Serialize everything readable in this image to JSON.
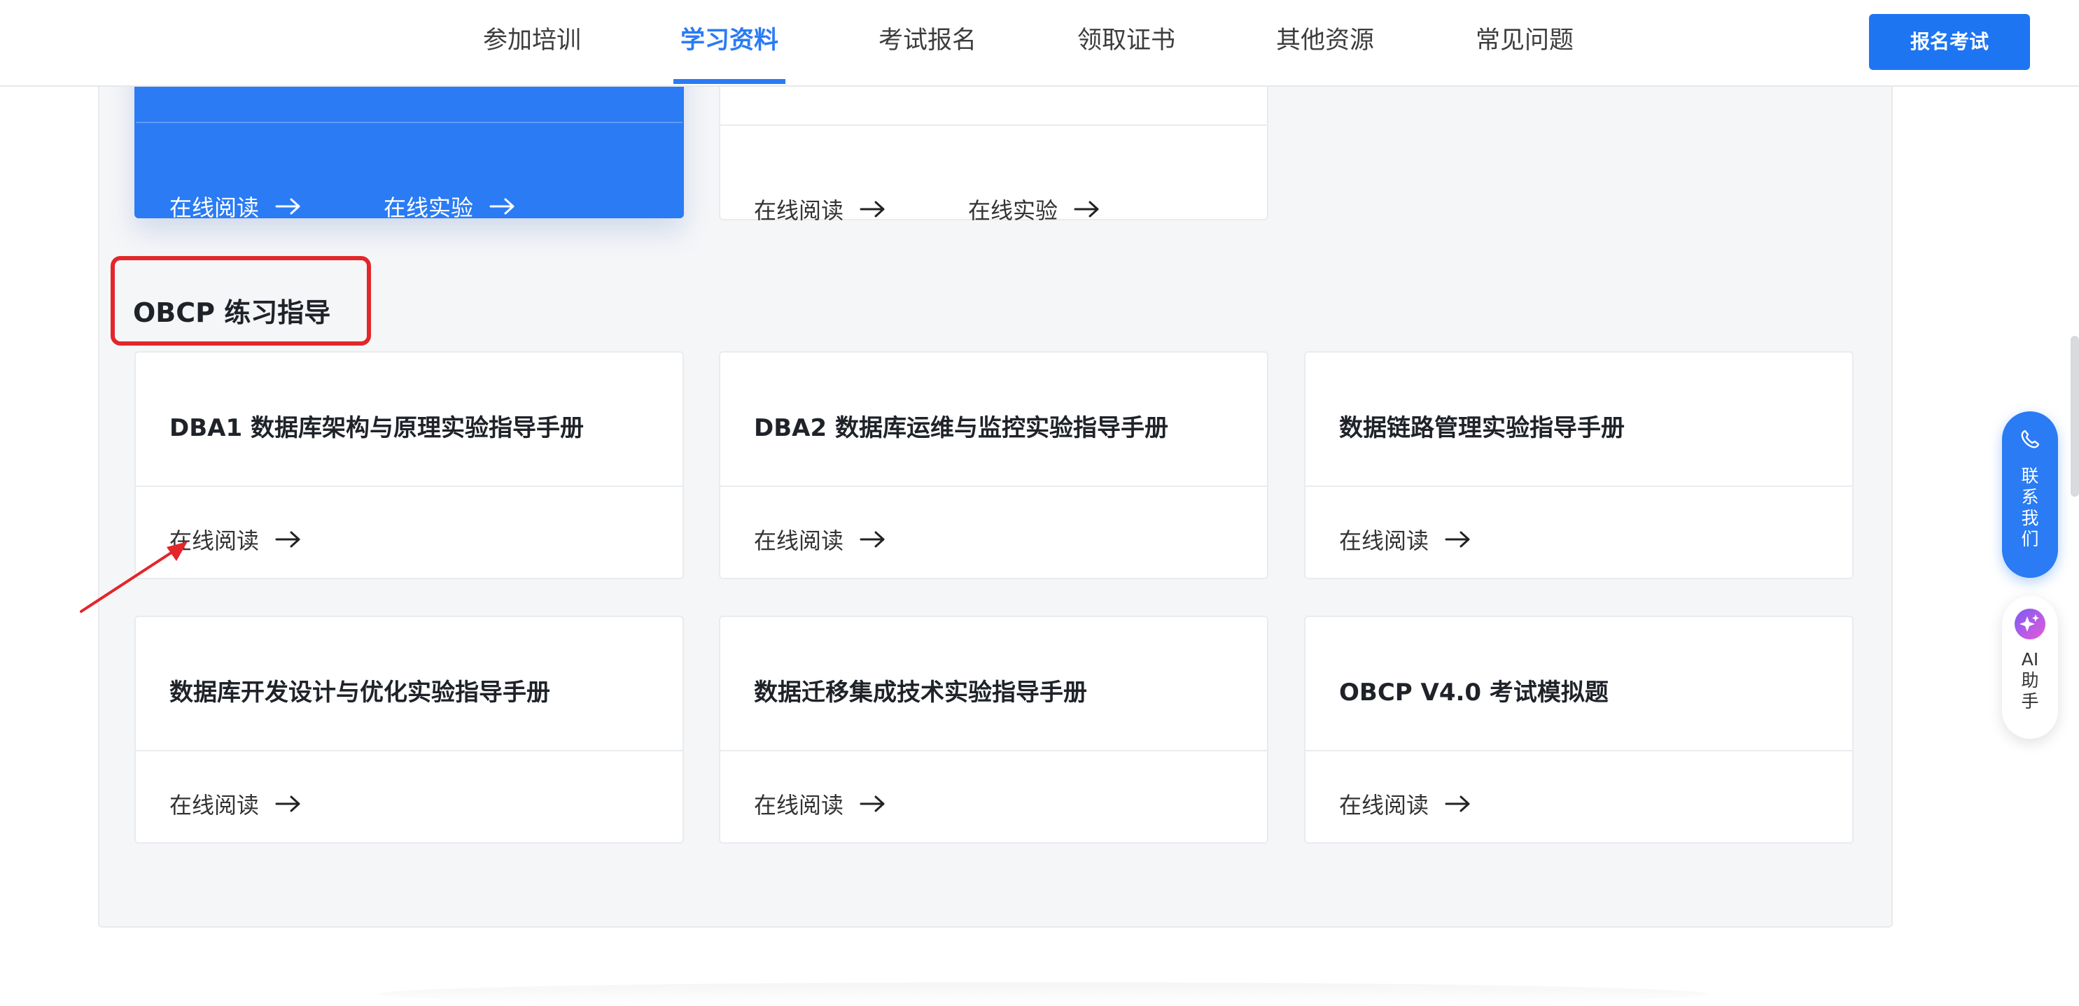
{
  "nav": {
    "items": [
      {
        "label": "参加培训",
        "active": false
      },
      {
        "label": "学习资料",
        "active": true
      },
      {
        "label": "考试报名",
        "active": false
      },
      {
        "label": "领取证书",
        "active": false
      },
      {
        "label": "其他资源",
        "active": false
      },
      {
        "label": "常见问题",
        "active": false
      }
    ],
    "cta_label": "报名考试"
  },
  "top_cards": [
    {
      "links": [
        "在线阅读",
        "在线实验"
      ],
      "highlighted": true
    },
    {
      "links": [
        "在线阅读",
        "在线实验"
      ],
      "highlighted": false
    }
  ],
  "section": {
    "title": "OBCP 练习指导"
  },
  "practice_cards": [
    {
      "title": "DBA1 数据库架构与原理实验指导手册",
      "link": "在线阅读"
    },
    {
      "title": "DBA2 数据库运维与监控实验指导手册",
      "link": "在线阅读"
    },
    {
      "title": "数据链路管理实验指导手册",
      "link": "在线阅读"
    },
    {
      "title": "数据库开发设计与优化实验指导手册",
      "link": "在线阅读"
    },
    {
      "title": "数据迁移集成技术实验指导手册",
      "link": "在线阅读"
    },
    {
      "title": "OBCP V4.0 考试模拟题",
      "link": "在线阅读"
    }
  ],
  "side_widgets": {
    "contact_label": "联系我们",
    "ai_label": "AI助手"
  },
  "colors": {
    "accent": "#2a7bf4",
    "annotation_red": "#e3262a",
    "panel_bg": "#f5f6f8"
  }
}
